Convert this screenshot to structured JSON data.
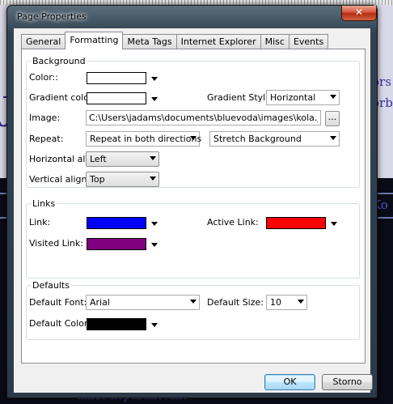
{
  "background": {
    "letter": "J",
    "side_text_1": "ors",
    "side_text_2": "orb",
    "side_text_3": "Ko",
    "footer_text": "nikde nepublikované"
  },
  "dialog": {
    "title": "Page Properties",
    "close_label": "✕",
    "tabs": [
      {
        "label": "General"
      },
      {
        "label": "Formatting"
      },
      {
        "label": "Meta Tags"
      },
      {
        "label": "Internet Explorer"
      },
      {
        "label": "Misc"
      },
      {
        "label": "Events"
      }
    ],
    "background": {
      "legend": "Background",
      "color_label": "Color::",
      "color_value": "#ffffff",
      "gradient_color_label": "Gradient color:",
      "gradient_color_value": "#ffffff",
      "gradient_style_label": "Gradient Style:",
      "gradient_style_value": "Horizontal",
      "image_label": "Image:",
      "image_value": "C:\\Users\\jadams\\documents\\bluevoda\\images\\kola.jpg",
      "browse_label": "...",
      "repeat_label": "Repeat:",
      "repeat_value": "Repeat in both directions",
      "stretch_value": "Stretch Background",
      "halign_label": "Horizontal align:",
      "halign_value": "Left",
      "valign_label": "Vertical align:",
      "valign_value": "Top"
    },
    "links": {
      "legend": "Links",
      "link_label": "Link:",
      "link_color": "#0000ff",
      "active_label": "Active Link:",
      "active_color": "#ff0000",
      "visited_label": "Visited Link:",
      "visited_color": "#800080"
    },
    "defaults": {
      "legend": "Defaults",
      "font_label": "Default Font:",
      "font_value": "Arial",
      "size_label": "Default Size:",
      "size_value": "10",
      "color_label": "Default Color:",
      "color_value": "#000000"
    },
    "ok_label": "OK",
    "cancel_label": "Storno"
  }
}
